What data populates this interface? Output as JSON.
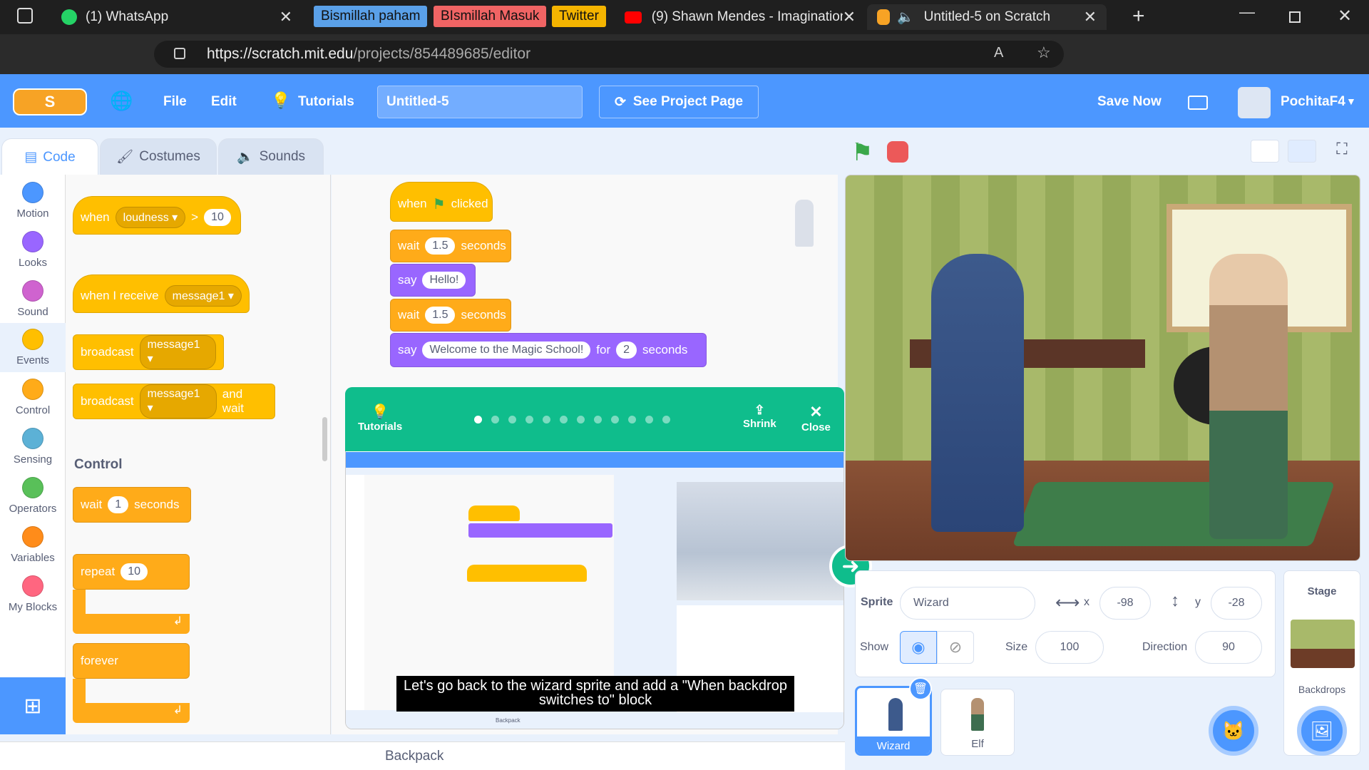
{
  "browser": {
    "tabs": [
      {
        "label": "(1) WhatsApp"
      },
      {
        "label": "(9) Shawn Mendes - Imagination"
      },
      {
        "label": "Untitled-5 on Scratch"
      }
    ],
    "bookmarks": [
      "Bismillah paham",
      "BIsmillah Masuk",
      "Twitter"
    ],
    "url_host": "https://scratch.mit.edu",
    "url_path": "/projects/854489685/editor"
  },
  "menu": {
    "file": "File",
    "edit": "Edit",
    "tutorials": "Tutorials",
    "project_title": "Untitled-5",
    "see_project": "See Project Page",
    "save_now": "Save Now",
    "username": "PochitaF4"
  },
  "editor_tabs": {
    "code": "Code",
    "costumes": "Costumes",
    "sounds": "Sounds"
  },
  "categories": [
    {
      "label": "Motion",
      "color": "#4c97ff"
    },
    {
      "label": "Looks",
      "color": "#9966ff"
    },
    {
      "label": "Sound",
      "color": "#cf63cf"
    },
    {
      "label": "Events",
      "color": "#ffbf00"
    },
    {
      "label": "Control",
      "color": "#ffab19"
    },
    {
      "label": "Sensing",
      "color": "#5cb1d6"
    },
    {
      "label": "Operators",
      "color": "#59c059"
    },
    {
      "label": "Variables",
      "color": "#ff8c1a"
    },
    {
      "label": "My Blocks",
      "color": "#ff6680"
    }
  ],
  "palette": {
    "when_loudness": {
      "when": "when",
      "menu": "loudness",
      "op": ">",
      "value": "10"
    },
    "when_receive": {
      "label": "when I receive",
      "menu": "message1"
    },
    "broadcast": {
      "label": "broadcast",
      "menu": "message1"
    },
    "broadcast_wait": {
      "label": "broadcast",
      "menu": "message1",
      "suffix": "and wait"
    },
    "control_heading": "Control",
    "wait": {
      "label": "wait",
      "value": "1",
      "suffix": "seconds"
    },
    "repeat": {
      "label": "repeat",
      "value": "10"
    },
    "forever": {
      "label": "forever"
    }
  },
  "script": {
    "hat": {
      "when": "when",
      "clicked": "clicked"
    },
    "wait1": {
      "label": "wait",
      "value": "1.5",
      "suffix": "seconds"
    },
    "say1": {
      "label": "say",
      "value": "Hello!"
    },
    "wait2": {
      "label": "wait",
      "value": "1.5",
      "suffix": "seconds"
    },
    "say2": {
      "label": "say",
      "value": "Welcome to the Magic School!",
      "for": "for",
      "secs": "2",
      "suffix": "seconds"
    }
  },
  "tutorial": {
    "label": "Tutorials",
    "shrink": "Shrink",
    "close": "Close",
    "caption": "Let's go back to the wizard sprite and add a \"When backdrop switches to\" block",
    "video_backpack": "Backpack"
  },
  "sprite_info": {
    "sprite_label": "Sprite",
    "sprite_name": "Wizard",
    "x_label": "x",
    "x": "-98",
    "y_label": "y",
    "y": "-28",
    "show_label": "Show",
    "size_label": "Size",
    "size": "100",
    "direction_label": "Direction",
    "direction": "90"
  },
  "sprites": [
    {
      "name": "Wizard"
    },
    {
      "name": "Elf"
    }
  ],
  "stage_pane": {
    "title": "Stage",
    "backdrops": "Backdrops"
  },
  "backpack": "Backpack"
}
